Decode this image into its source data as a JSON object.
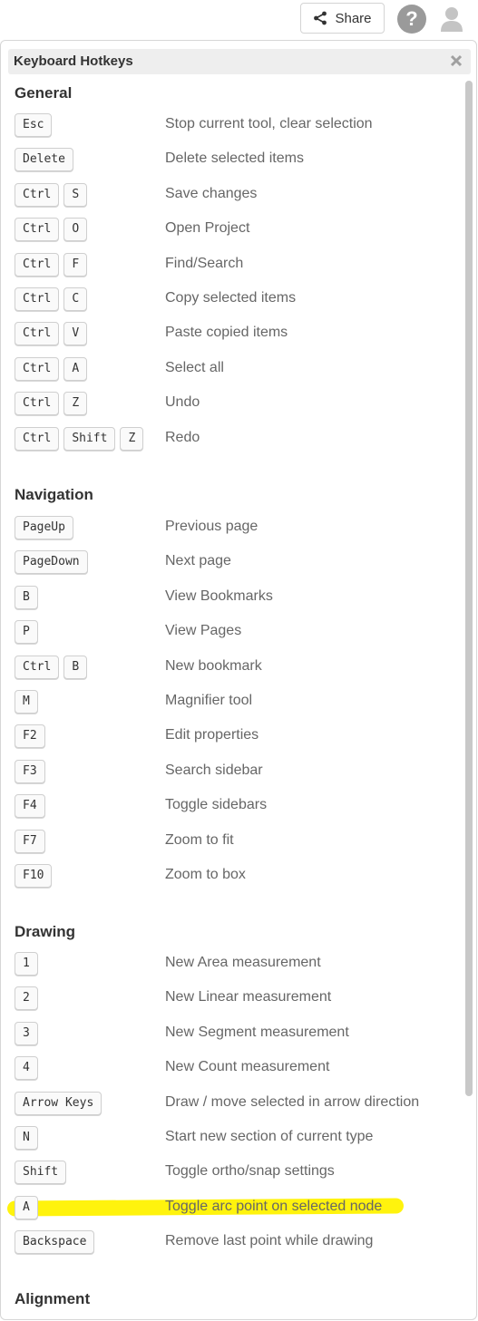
{
  "header": {
    "share_label": "Share"
  },
  "panel": {
    "title": "Keyboard Hotkeys"
  },
  "colors": {
    "highlight": "#fff200",
    "key_border": "#cfcfcf",
    "desc_text": "#666666"
  },
  "sections": [
    {
      "title": "General",
      "rows": [
        {
          "keys": [
            "Esc"
          ],
          "desc": "Stop current tool, clear selection"
        },
        {
          "keys": [
            "Delete"
          ],
          "desc": "Delete selected items"
        },
        {
          "keys": [
            "Ctrl",
            "S"
          ],
          "desc": "Save changes"
        },
        {
          "keys": [
            "Ctrl",
            "O"
          ],
          "desc": "Open Project"
        },
        {
          "keys": [
            "Ctrl",
            "F"
          ],
          "desc": "Find/Search"
        },
        {
          "keys": [
            "Ctrl",
            "C"
          ],
          "desc": "Copy selected items"
        },
        {
          "keys": [
            "Ctrl",
            "V"
          ],
          "desc": "Paste copied items"
        },
        {
          "keys": [
            "Ctrl",
            "A"
          ],
          "desc": "Select all"
        },
        {
          "keys": [
            "Ctrl",
            "Z"
          ],
          "desc": "Undo"
        },
        {
          "keys": [
            "Ctrl",
            "Shift",
            "Z"
          ],
          "desc": "Redo"
        }
      ]
    },
    {
      "title": "Navigation",
      "rows": [
        {
          "keys": [
            "PageUp"
          ],
          "desc": "Previous page"
        },
        {
          "keys": [
            "PageDown"
          ],
          "desc": "Next page"
        },
        {
          "keys": [
            "B"
          ],
          "desc": "View Bookmarks"
        },
        {
          "keys": [
            "P"
          ],
          "desc": "View Pages"
        },
        {
          "keys": [
            "Ctrl",
            "B"
          ],
          "desc": "New bookmark"
        },
        {
          "keys": [
            "M"
          ],
          "desc": "Magnifier tool"
        },
        {
          "keys": [
            "F2"
          ],
          "desc": "Edit properties"
        },
        {
          "keys": [
            "F3"
          ],
          "desc": "Search sidebar"
        },
        {
          "keys": [
            "F4"
          ],
          "desc": "Toggle sidebars"
        },
        {
          "keys": [
            "F7"
          ],
          "desc": "Zoom to fit"
        },
        {
          "keys": [
            "F10"
          ],
          "desc": "Zoom to box"
        }
      ]
    },
    {
      "title": "Drawing",
      "rows": [
        {
          "keys": [
            "1"
          ],
          "desc": "New Area measurement"
        },
        {
          "keys": [
            "2"
          ],
          "desc": "New Linear measurement"
        },
        {
          "keys": [
            "3"
          ],
          "desc": "New Segment measurement"
        },
        {
          "keys": [
            "4"
          ],
          "desc": "New Count measurement"
        },
        {
          "keys": [
            "Arrow Keys"
          ],
          "desc": "Draw / move selected in arrow direction"
        },
        {
          "keys": [
            "N"
          ],
          "desc": "Start new section of current type"
        },
        {
          "keys": [
            "Shift"
          ],
          "desc": "Toggle ortho/snap settings"
        },
        {
          "keys": [
            "A"
          ],
          "desc": "Toggle arc point on selected node"
        },
        {
          "keys": [
            "Backspace"
          ],
          "desc": "Remove last point while drawing"
        }
      ]
    },
    {
      "title": "Alignment",
      "rows": []
    }
  ]
}
